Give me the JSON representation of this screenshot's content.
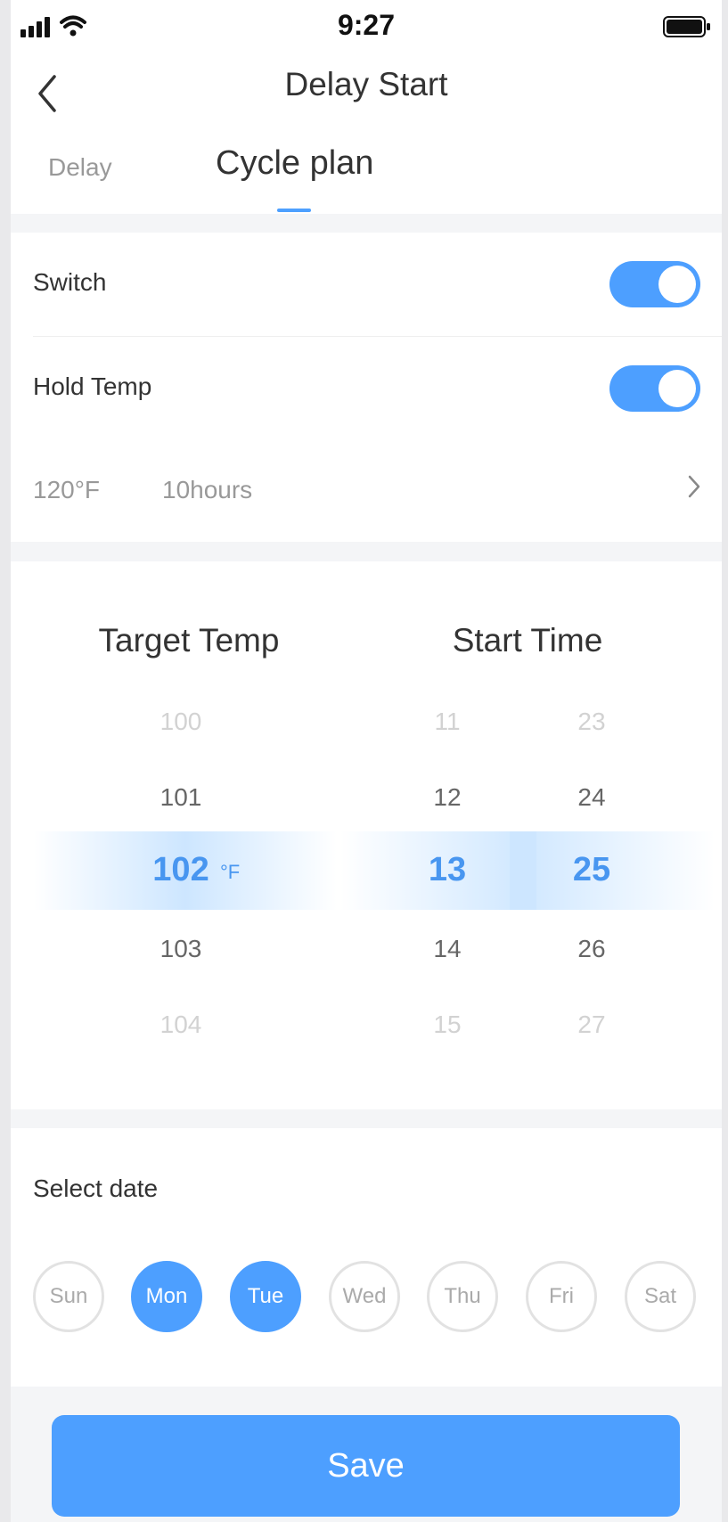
{
  "status_bar": {
    "time": "9:27",
    "signal_icon": "cellular-signal-icon",
    "wifi_icon": "wifi-icon",
    "battery_icon": "battery-icon"
  },
  "nav": {
    "title": "Delay Start",
    "back_icon": "chevron-left-icon"
  },
  "tabs": [
    {
      "label": "Delay",
      "active": false
    },
    {
      "label": "Cycle plan",
      "active": true
    }
  ],
  "settings": {
    "switch": {
      "label": "Switch",
      "on": true
    },
    "hold_temp": {
      "label": "Hold Temp",
      "on": true,
      "temp": "120°F",
      "duration": "10hours"
    }
  },
  "picker": {
    "target_temp_title": "Target Temp",
    "start_time_title": "Start Time",
    "temp_values": [
      "100",
      "101",
      "102",
      "103",
      "104"
    ],
    "temp_unit": "°F",
    "hour_values": [
      "11",
      "12",
      "13",
      "14",
      "15"
    ],
    "minute_values": [
      "23",
      "24",
      "25",
      "26",
      "27"
    ],
    "selected_index": 2
  },
  "date": {
    "label": "Select date",
    "days": [
      {
        "label": "Sun",
        "selected": false
      },
      {
        "label": "Mon",
        "selected": true
      },
      {
        "label": "Tue",
        "selected": true
      },
      {
        "label": "Wed",
        "selected": false
      },
      {
        "label": "Thu",
        "selected": false
      },
      {
        "label": "Fri",
        "selected": false
      },
      {
        "label": "Sat",
        "selected": false
      }
    ]
  },
  "save_label": "Save",
  "colors": {
    "accent": "#4d9fff",
    "selected_text": "#4896f0",
    "background": "#f4f5f7"
  }
}
